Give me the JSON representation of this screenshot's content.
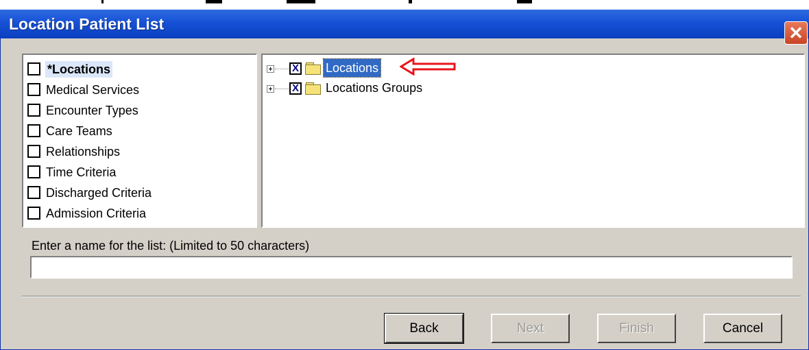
{
  "window": {
    "title": "Location Patient List",
    "close_symbol": "✕"
  },
  "criteria": {
    "items": [
      {
        "label": "*Locations",
        "checked": false,
        "selected": true
      },
      {
        "label": "Medical Services",
        "checked": false
      },
      {
        "label": "Encounter Types",
        "checked": false
      },
      {
        "label": "Care Teams",
        "checked": false
      },
      {
        "label": "Relationships",
        "checked": false
      },
      {
        "label": "Time Criteria",
        "checked": false
      },
      {
        "label": "Discharged Criteria",
        "checked": false
      },
      {
        "label": "Admission Criteria",
        "checked": false
      }
    ]
  },
  "tree": {
    "items": [
      {
        "label": "Locations",
        "checked": true,
        "selected": true,
        "icon": "folder-icon"
      },
      {
        "label": "Locations Groups",
        "checked": true,
        "selected": false,
        "icon": "folder-icon"
      }
    ],
    "check_mark": "X"
  },
  "name_field": {
    "label": "Enter a name for the list: (Limited to 50 characters)",
    "value": "",
    "placeholder": ""
  },
  "buttons": {
    "back": "Back",
    "next": "Next",
    "finish": "Finish",
    "cancel": "Cancel"
  },
  "colors": {
    "title_bar": "#0a3fbf",
    "selection": "#316ac5",
    "annotation_arrow": "#e8141b"
  }
}
